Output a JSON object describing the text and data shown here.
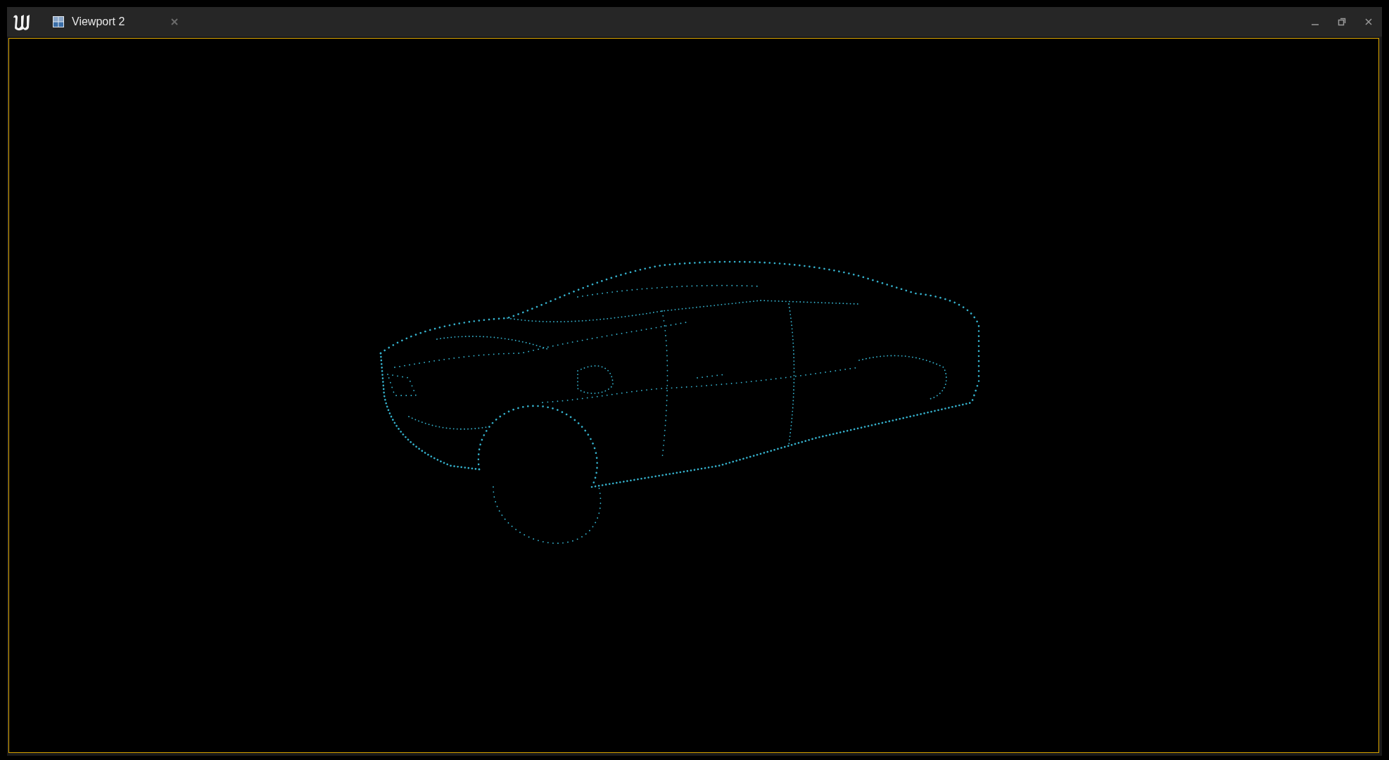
{
  "tabs": [
    {
      "label": "Viewport 2",
      "selected": true
    }
  ],
  "viewport": {
    "focused": true
  }
}
